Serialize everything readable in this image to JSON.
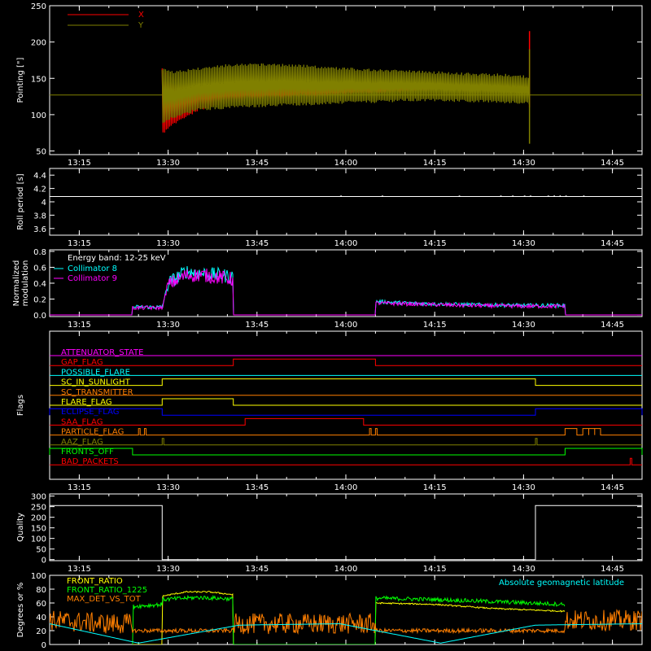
{
  "time_axis": {
    "xlim": [
      "13:10",
      "14:50"
    ],
    "ticks": [
      "13:15",
      "13:30",
      "13:45",
      "14:00",
      "14:15",
      "14:30",
      "14:45"
    ]
  },
  "chart_data": [
    {
      "type": "line",
      "ylabel": "Pointing [\"]",
      "ylim": [
        45,
        250
      ],
      "yticks": [
        50,
        100,
        150,
        200,
        250
      ],
      "legend": [
        {
          "label": "X",
          "color": "#ff0000"
        },
        {
          "label": "Y",
          "color": "#808000"
        }
      ],
      "reference_level": 127,
      "reference_color": "#808000",
      "active_interval": [
        "13:29",
        "14:31"
      ],
      "series": [
        {
          "name": "X",
          "color": "#ff0000",
          "x": [
            "13:29",
            "13:31",
            "13:35",
            "13:40",
            "13:45",
            "13:50",
            "13:55",
            "14:00",
            "14:05",
            "14:10",
            "14:15",
            "14:20",
            "14:25",
            "14:30",
            "14:31"
          ],
          "min": [
            72,
            85,
            105,
            115,
            118,
            120,
            122,
            124,
            126,
            128,
            130,
            130,
            129,
            127,
            125
          ],
          "max": [
            165,
            150,
            145,
            142,
            141,
            140,
            141,
            142,
            143,
            144,
            145,
            145,
            144,
            143,
            140
          ],
          "spikes": [
            {
              "x": "14:31",
              "min": 110,
              "max": 215
            }
          ]
        },
        {
          "name": "Y",
          "color": "#808000",
          "x": [
            "13:29",
            "13:31",
            "13:35",
            "13:40",
            "13:45",
            "13:50",
            "13:55",
            "14:00",
            "14:05",
            "14:10",
            "14:15",
            "14:20",
            "14:25",
            "14:30",
            "14:31"
          ],
          "min": [
            85,
            95,
            105,
            108,
            110,
            112,
            113,
            115,
            116,
            118,
            118,
            117,
            116,
            115,
            112
          ],
          "max": [
            165,
            160,
            165,
            170,
            171,
            170,
            168,
            165,
            163,
            162,
            160,
            158,
            157,
            155,
            150
          ],
          "spikes": [
            {
              "x": "14:31",
              "min": 60,
              "max": 190
            }
          ]
        }
      ]
    },
    {
      "type": "line",
      "ylabel": "Roll period [s]",
      "ylim": [
        3.5,
        4.5
      ],
      "yticks": [
        3.6,
        3.8,
        4.0,
        4.2,
        4.4
      ],
      "series": [
        {
          "name": "",
          "color": "#ffffff",
          "x": [
            "13:10",
            "14:50"
          ],
          "y": [
            4.08,
            4.08
          ],
          "blips": [
            "13:59",
            "14:06",
            "14:19",
            "14:26",
            "14:28",
            "14:30",
            "14:31",
            "14:34",
            "14:35",
            "14:36",
            "14:37",
            "14:40"
          ]
        }
      ]
    },
    {
      "type": "line",
      "ylabel": "Normalized modulation",
      "ylim": [
        -0.02,
        0.82
      ],
      "yticks": [
        0.0,
        0.2,
        0.4,
        0.6,
        0.8
      ],
      "annotations": [
        "Energy band: 12-25 keV"
      ],
      "legend": [
        {
          "label": "Collimator 8",
          "color": "#00ffff"
        },
        {
          "label": "Collimator 9",
          "color": "#ff00ff"
        }
      ],
      "series": [
        {
          "name": "Collimator 8",
          "color": "#00ffff",
          "segments": [
            {
              "x": [
                "13:10",
                "13:24",
                "13:24",
                "13:29",
                "13:30",
                "13:33",
                "13:36",
                "13:39",
                "13:41",
                "13:41",
                "14:05",
                "14:05",
                "14:10",
                "14:20",
                "14:30",
                "14:37",
                "14:37",
                "14:50"
              ],
              "y": [
                0,
                0,
                0.1,
                0.1,
                0.4,
                0.55,
                0.52,
                0.5,
                0.48,
                0,
                0,
                0.17,
                0.15,
                0.13,
                0.12,
                0.12,
                0,
                0
              ]
            }
          ]
        },
        {
          "name": "Collimator 9",
          "color": "#ff00ff",
          "segments": [
            {
              "x": [
                "13:10",
                "13:24",
                "13:24",
                "13:29",
                "13:30",
                "13:33",
                "13:36",
                "13:39",
                "13:41",
                "13:41",
                "14:05",
                "14:05",
                "14:10",
                "14:20",
                "14:30",
                "14:37",
                "14:37",
                "14:50"
              ],
              "y": [
                0,
                0,
                0.09,
                0.09,
                0.38,
                0.5,
                0.5,
                0.47,
                0.45,
                0,
                0,
                0.15,
                0.14,
                0.12,
                0.11,
                0.11,
                0,
                0
              ]
            }
          ]
        }
      ]
    },
    {
      "type": "line",
      "ylabel": "Flags",
      "flags": [
        {
          "name": "ATTENUATOR_STATE",
          "color": "#ff00ff",
          "on": []
        },
        {
          "name": "GAP_FLAG",
          "color": "#ff0000",
          "on": [
            [
              "13:41",
              "14:05"
            ]
          ]
        },
        {
          "name": "POSSIBLE_FLARE",
          "color": "#00ffff",
          "on": []
        },
        {
          "name": "SC_IN_SUNLIGHT",
          "color": "#ffff00",
          "on": [
            [
              "13:29",
              "14:32"
            ]
          ]
        },
        {
          "name": "SC_TRANSMITTER",
          "color": "#ff7f00",
          "on": []
        },
        {
          "name": "FLARE_FLAG",
          "color": "#ffff00",
          "on": [
            [
              "13:29",
              "13:41"
            ]
          ]
        },
        {
          "name": "ECLIPSE_FLAG",
          "color": "#0000ff",
          "on": [
            [
              "13:10",
              "13:29"
            ],
            [
              "14:32",
              "14:50"
            ]
          ]
        },
        {
          "name": "SAA_FLAG",
          "color": "#ff0000",
          "on": [
            [
              "13:43",
              "14:03"
            ]
          ]
        },
        {
          "name": "PARTICLE_FLAG",
          "color": "#ff7f00",
          "on": [
            [
              "13:25",
              "13:25"
            ],
            [
              "13:26",
              "13:26"
            ],
            [
              "14:04",
              "14:04"
            ],
            [
              "14:05",
              "14:05"
            ],
            [
              "14:37",
              "14:39"
            ],
            [
              "14:40",
              "14:41"
            ],
            [
              "14:41",
              "14:42"
            ],
            [
              "14:42",
              "14:43"
            ]
          ]
        },
        {
          "name": "AAZ_FLAG",
          "color": "#808000",
          "on": [
            [
              "13:29",
              "13:29"
            ],
            [
              "14:32",
              "14:32"
            ]
          ]
        },
        {
          "name": "FRONTS_OFF",
          "color": "#00ff00",
          "on": [
            [
              "13:10",
              "13:24"
            ],
            [
              "14:37",
              "14:50"
            ]
          ]
        },
        {
          "name": "BAD_PACKETS",
          "color": "#ff0000",
          "on": [
            [
              "14:48",
              "14:48"
            ]
          ]
        }
      ]
    },
    {
      "type": "line",
      "ylabel": "Quality",
      "ylim": [
        -5,
        310
      ],
      "yticks": [
        0,
        50,
        100,
        150,
        200,
        250,
        300
      ],
      "series": [
        {
          "name": "",
          "color": "#ffffff",
          "x": [
            "13:10",
            "13:29",
            "13:29",
            "14:32",
            "14:32",
            "14:50"
          ],
          "y": [
            255,
            255,
            0,
            0,
            255,
            255
          ]
        }
      ]
    },
    {
      "type": "line",
      "ylabel": "Degrees or %",
      "ylim": [
        0,
        100
      ],
      "yticks": [
        0,
        20,
        40,
        60,
        80,
        100
      ],
      "legend": [
        {
          "label": "FRONT_RATIO",
          "color": "#ffff00"
        },
        {
          "label": "FRONT_RATIO_1225",
          "color": "#00ff00"
        },
        {
          "label": "MAX_DET_VS_TOT",
          "color": "#ff7f00"
        },
        {
          "label": "Absolute geomagnetic latitude",
          "color": "#00ffff"
        }
      ],
      "series": [
        {
          "name": "FRONT_RATIO",
          "color": "#ffff00",
          "x": [
            "13:24",
            "13:29",
            "13:29",
            "13:33",
            "13:37",
            "13:41",
            "13:41",
            "14:05",
            "14:05",
            "14:15",
            "14:25",
            "14:37",
            "14:37"
          ],
          "y": [
            0,
            0,
            70,
            76,
            76,
            72,
            0,
            0,
            60,
            58,
            52,
            48,
            0
          ]
        },
        {
          "name": "FRONT_RATIO_1225",
          "color": "#00ff00",
          "x": [
            "13:24",
            "13:24",
            "13:29",
            "13:29",
            "13:35",
            "13:41",
            "13:41",
            "14:05",
            "14:05",
            "14:15",
            "14:25",
            "14:37",
            "14:37"
          ],
          "y": [
            0,
            55,
            58,
            65,
            68,
            66,
            0,
            0,
            67,
            65,
            62,
            58,
            0
          ]
        },
        {
          "name": "MAX_DET_VS_TOT",
          "color": "#ff7f00",
          "x": [
            "13:10",
            "13:20",
            "13:24",
            "13:24",
            "13:41",
            "13:41",
            "14:05",
            "14:05",
            "14:37",
            "14:37",
            "14:50"
          ],
          "y": [
            35,
            30,
            30,
            20,
            20,
            30,
            30,
            20,
            20,
            35,
            35
          ]
        },
        {
          "name": "Absolute geomagnetic latitude",
          "color": "#00ffff",
          "x": [
            "13:10",
            "13:25",
            "13:42",
            "13:59",
            "14:16",
            "14:32",
            "14:50"
          ],
          "y": [
            30,
            2,
            28,
            30,
            2,
            28,
            30
          ]
        }
      ]
    }
  ]
}
